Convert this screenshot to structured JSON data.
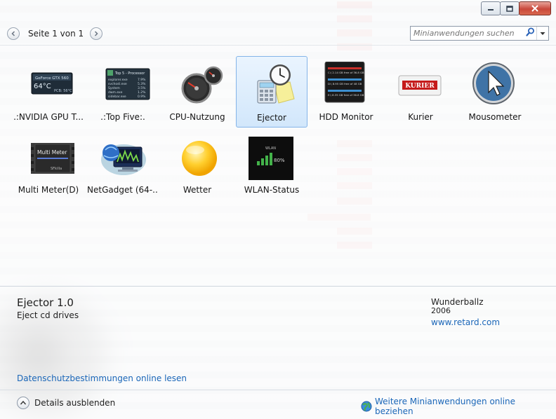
{
  "window": {
    "minimize_icon": "minimize-icon",
    "maximize_icon": "maximize-icon",
    "close_icon": "close-icon"
  },
  "pager": {
    "label": "Seite 1 von 1"
  },
  "search": {
    "placeholder": "Minianwendungen suchen"
  },
  "gadgets": [
    {
      "name": ".:NVIDIA GPU T...",
      "icon": "nvidia-gpu-icon",
      "selected": false
    },
    {
      "name": ".:Top Five:.",
      "icon": "top-five-icon",
      "selected": false
    },
    {
      "name": "CPU-Nutzung",
      "icon": "cpu-meter-icon",
      "selected": false
    },
    {
      "name": "Ejector",
      "icon": "ejector-icon",
      "selected": true
    },
    {
      "name": "HDD Monitor",
      "icon": "hdd-monitor-icon",
      "selected": false
    },
    {
      "name": "Kurier",
      "icon": "kurier-icon",
      "selected": false
    },
    {
      "name": "Mousometer",
      "icon": "mousometer-icon",
      "selected": false
    },
    {
      "name": "Multi Meter(D)",
      "icon": "multi-meter-icon",
      "selected": false
    },
    {
      "name": "NetGadget (64-...",
      "icon": "netgadget-icon",
      "selected": false
    },
    {
      "name": "Wetter",
      "icon": "weather-sun-icon",
      "selected": false
    },
    {
      "name": "WLAN-Status",
      "icon": "wlan-status-icon",
      "selected": false
    }
  ],
  "gadget_previews": {
    "nvidia": {
      "line1": "GeForce GTX 560",
      "temp": "64°C",
      "pcb": "PCB: 56°C"
    },
    "topfive": {
      "title": "Top 5 - Processor",
      "rows": [
        "explorer.exe",
        "svchost.exe",
        "System",
        "dwm.exe",
        "sidebar.exe"
      ],
      "vals": [
        "7.9%",
        "5.3%",
        "3.5%",
        "1.2%",
        "0.9%"
      ]
    },
    "hdd": {
      "rows": [
        "C:\\ 2.14 GB free of 36.8 GB",
        "D:\\ 8.95 GB free of 48 GB",
        "E:\\ 8.35 GB free of 36.8 GB"
      ]
    },
    "kurier": {
      "logo": "KURIER"
    },
    "multimeter": {
      "line1": "Multi Meter",
      "line2": "SFkilla"
    },
    "wlan": {
      "label": "WLAN",
      "value": "80%"
    }
  },
  "details": {
    "title": "Ejector 1.0",
    "description": "Eject cd drives",
    "author": "Wunderballz",
    "year": "2006",
    "website": "www.retard.com",
    "privacy_link": "Datenschutzbestimmungen online lesen"
  },
  "footer": {
    "toggle_label": "Details ausblenden",
    "more_label": "Weitere Minianwendungen online beziehen"
  },
  "colors": {
    "link": "#1a66b8",
    "selection_border": "#84b4e8",
    "selection_fill": "#d2e7fb"
  }
}
